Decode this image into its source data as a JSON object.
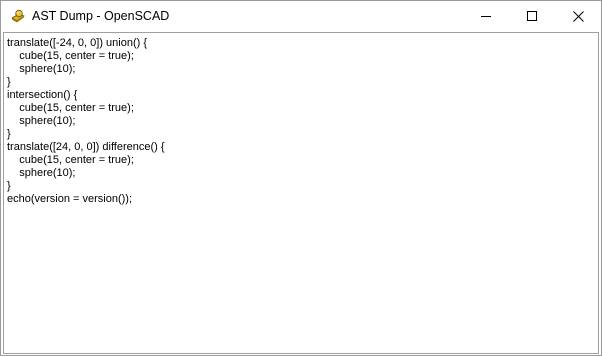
{
  "window": {
    "title": "AST Dump - OpenSCAD",
    "app_icon": "openscad-logo-icon",
    "controls": [
      "minimize-icon",
      "maximize-icon",
      "close-icon"
    ]
  },
  "editor": {
    "lines": [
      "translate([-24, 0, 0]) union() {",
      "    cube(15, center = true);",
      "    sphere(10);",
      "}",
      "intersection() {",
      "    cube(15, center = true);",
      "    sphere(10);",
      "}",
      "translate([24, 0, 0]) difference() {",
      "    cube(15, center = true);",
      "    sphere(10);",
      "}",
      "echo(version = version());"
    ]
  },
  "colors": {
    "icon_gold": "#d8b42a",
    "icon_dark": "#5a4a10",
    "border": "#9a9a9a"
  }
}
